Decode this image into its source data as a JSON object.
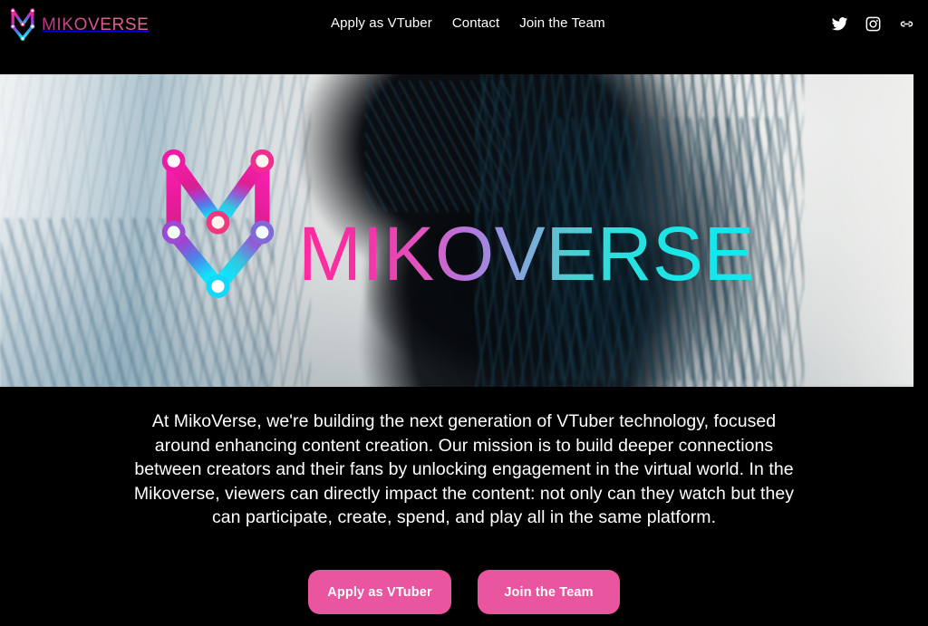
{
  "header": {
    "brand_name": "MIKOVERSE",
    "brand_mark_icon": "mikoverse-m-node-logo",
    "nav": [
      {
        "label": "Apply as VTuber"
      },
      {
        "label": "Contact"
      },
      {
        "label": "Join the Team"
      }
    ],
    "socials": [
      {
        "name": "twitter-icon",
        "label": "Twitter"
      },
      {
        "name": "instagram-icon",
        "label": "Instagram"
      },
      {
        "name": "link-icon",
        "label": "Link"
      }
    ]
  },
  "hero": {
    "logo_icon": "mikoverse-m-node-logo",
    "wordmark": "MIKOVERSE",
    "background_description": "dark silhouetted figure with teal textured hair on pale studio backdrop"
  },
  "mission": {
    "text": "At MikoVerse, we're building the next generation of VTuber technology, focused around enhancing content creation. Our mission is to build deeper connections between creators and their fans by unlocking engagement in the virtual world. In the Mikoverse, viewers can directly impact the content: not only can they watch but they can participate, create, spend, and play all in the same platform."
  },
  "cta": {
    "apply_label": "Apply as VTuber",
    "join_label": "Join the Team"
  },
  "colors": {
    "page_background": "#000000",
    "button_pink": "#e9559e",
    "wordmark_start": "#ff2aa0",
    "wordmark_mid": "#8f9ee0",
    "wordmark_end": "#10e9ee",
    "nav_text": "#ffffff",
    "brand_text": "#c84b84"
  }
}
